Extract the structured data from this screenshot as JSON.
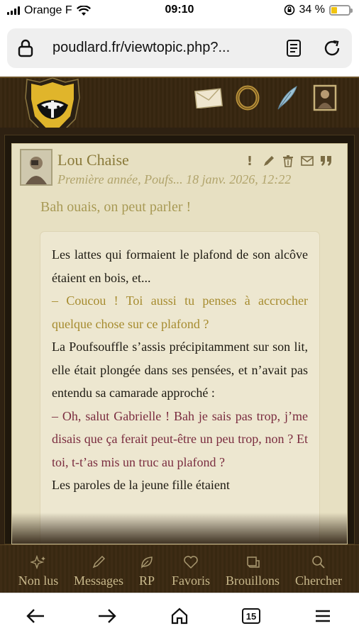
{
  "status_bar": {
    "carrier": "Orange F",
    "time": "09:10",
    "battery_percent": "34 %",
    "battery_level": 0.34
  },
  "browser": {
    "url": "poudlard.fr/viewtopic.php?...",
    "reader_icon": "reader-icon",
    "reload_icon": "reload-icon",
    "lock_icon": "lock-icon"
  },
  "header_icons": [
    "envelope-icon",
    "ring-icon",
    "quill-icon",
    "portrait-icon"
  ],
  "post": {
    "author": "Lou Chaise",
    "subline": "Première année, Poufs... 18 janv. 2026, 12:22",
    "title": "Bah ouais, on peut parler !",
    "actions": [
      "report-icon",
      "edit-icon",
      "delete-icon",
      "message-icon",
      "quote-icon"
    ],
    "paragraphs": [
      {
        "text": "Les lattes qui formaient le plafond de son alcôve étaient en bois, et...",
        "style": "normal"
      },
      {
        "text": "– Coucou ! Toi aussi tu penses à accrocher quelque chose sur ce plafond ?",
        "style": "gold"
      },
      {
        "text": "La Poufsouffle s’assis précipitamment sur son lit, elle était plongée dans ses pensées, et n’avait pas entendu sa camarade approché :",
        "style": "normal"
      },
      {
        "text": "– Oh, salut Gabrielle ! Bah je sais pas trop, j’me disais que ça ferait peut-être un peu trop, non ? Et toi, t-t’as mis un truc au plafond ?",
        "style": "plum"
      },
      {
        "text": "Les paroles de la jeune fille étaient",
        "style": "normal"
      }
    ]
  },
  "forum_nav": [
    {
      "label": "Non lus",
      "icon": "sparkle-icon"
    },
    {
      "label": "Messages",
      "icon": "pencil-icon"
    },
    {
      "label": "RP",
      "icon": "leaf-icon"
    },
    {
      "label": "Favoris",
      "icon": "heart-icon"
    },
    {
      "label": "Brouillons",
      "icon": "scroll-icon"
    },
    {
      "label": "Chercher",
      "icon": "search-icon"
    }
  ],
  "toolbar": {
    "tab_count": "15"
  }
}
